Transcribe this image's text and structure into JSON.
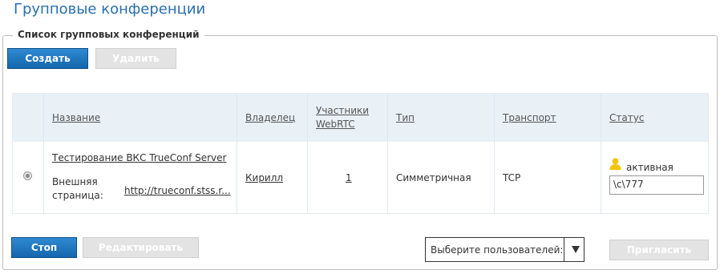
{
  "page": {
    "title": "Групповые конференции"
  },
  "section": {
    "legend": "Список групповых конференций"
  },
  "toolbar": {
    "create_label": "Создать",
    "delete_label": "Удалить"
  },
  "table": {
    "headers": {
      "name": "Название",
      "owner": "Владелец",
      "participants_line1": "Участники",
      "participants_line2": "WebRTC",
      "type": "Тип",
      "transport": "Транспорт",
      "status": "Статус"
    },
    "rows": [
      {
        "name": "Тестирование ВКС TrueConf Server",
        "external_label_line1": "Внешняя",
        "external_label_line2": "страница:",
        "external_link": "http://trueconf.stss.r...",
        "owner": "Кирилл",
        "participants": "1",
        "type": "Симметричная",
        "transport": "TCP",
        "status": "активная",
        "status_value": "\\c\\777"
      }
    ]
  },
  "footer": {
    "stop_label": "Стоп",
    "edit_label": "Редактировать",
    "users_select": "Выберите пользователей:",
    "invite_label": "Пригласить"
  },
  "colors": {
    "accent": "#1a6fb5",
    "status_icon": "#f5c400"
  }
}
